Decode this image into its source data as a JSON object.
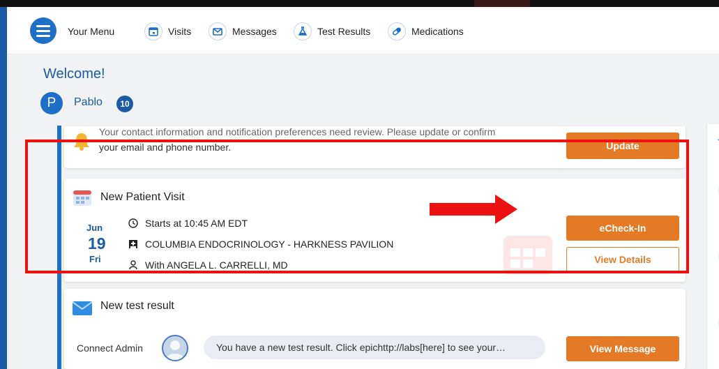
{
  "nav": {
    "menu_label": "Your Menu",
    "items": [
      {
        "label": "Visits",
        "icon": "calendar-icon"
      },
      {
        "label": "Messages",
        "icon": "envelope-icon"
      },
      {
        "label": "Test Results",
        "icon": "flask-icon"
      },
      {
        "label": "Medications",
        "icon": "pill-icon"
      }
    ]
  },
  "welcome": {
    "title": "Welcome!",
    "avatar_initial": "P",
    "user_name": "Pablo",
    "badge_count": "10"
  },
  "notice": {
    "text_partial": "Your contact information and notification preferences need review. Please update or confirm",
    "text_line2": "your email and phone number.",
    "button": "Update"
  },
  "visit": {
    "title": "New Patient Visit",
    "month": "Jun",
    "day": "19",
    "weekday": "Fri",
    "time": "Starts at 10:45 AM EDT",
    "location": "COLUMBIA ENDOCRINOLOGY - HARKNESS PAVILION",
    "provider": "With ANGELA L. CARRELLI, MD",
    "checkin_button": "eCheck-In",
    "details_button": "View Details"
  },
  "test_result": {
    "title": "New test result",
    "from": "Connect Admin",
    "message": "You have a new test result. Click epichttp://labs[here] to see your…",
    "button": "View Message"
  },
  "right_panel": {
    "letter": "Y"
  },
  "colors": {
    "brand_blue": "#1b5aa6",
    "accent_orange": "#e57a26",
    "annotation_red": "#ee1111"
  }
}
